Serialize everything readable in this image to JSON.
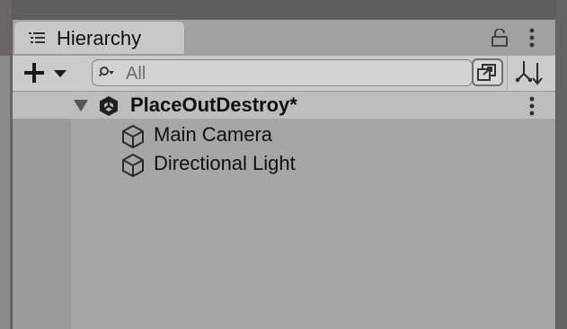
{
  "window": {
    "tab": {
      "label": "Hierarchy",
      "icon": "list-icon"
    },
    "tab_actions": [
      "lock-icon",
      "kebab-menu-icon"
    ]
  },
  "toolbar": {
    "add": {
      "icon": "plus-icon",
      "dropdown": "caret-down-icon"
    },
    "search": {
      "placeholder": "All",
      "value": "",
      "icon": "search-icon"
    },
    "scene_visibility": {
      "icon": "scene-visibility-icon"
    },
    "sort": {
      "icon": "sort-icon"
    }
  },
  "hierarchy": {
    "scene": {
      "name": "PlaceOutDestroy*",
      "expanded": true,
      "icon": "unity-scene-icon"
    },
    "items": [
      {
        "label": "Main Camera",
        "icon": "gameobject-cube-icon"
      },
      {
        "label": "Directional Light",
        "icon": "gameobject-cube-icon"
      }
    ]
  },
  "colors": {
    "tab_bg": "#c8c8c8",
    "toolbar_bg": "#cbcbcb",
    "scene_row_bg": "#bdbdbd",
    "panel_bg": "#a6a6a6"
  }
}
